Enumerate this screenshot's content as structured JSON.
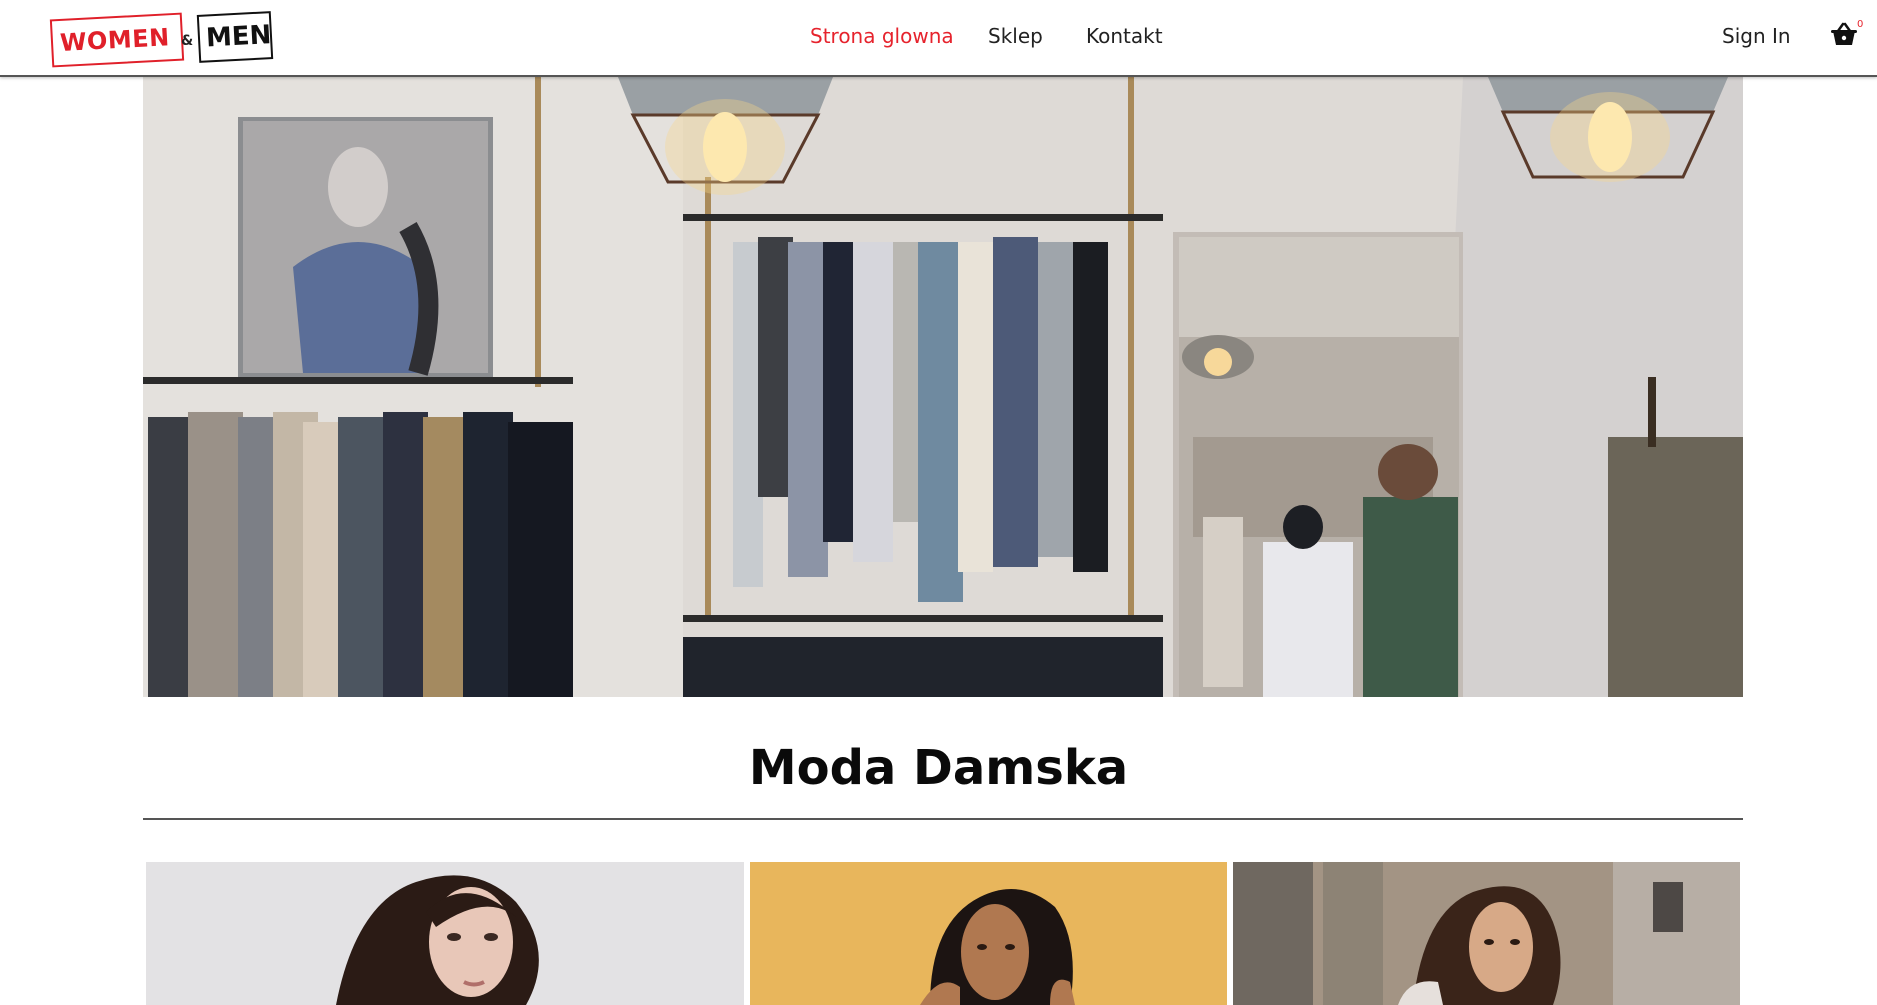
{
  "header": {
    "logo": {
      "women": "WOMEN",
      "amp": "&",
      "men": "MEN"
    },
    "nav": [
      {
        "label": "Strona glowna",
        "active": true
      },
      {
        "label": "Sklep",
        "active": false
      },
      {
        "label": "Kontakt",
        "active": false
      }
    ],
    "sign_in": "Sign In",
    "cart": {
      "icon": "basket-icon",
      "count": "0"
    }
  },
  "hero": {
    "image": "clothing-store-interior-photo"
  },
  "section": {
    "title": "Moda Damska"
  },
  "products": [
    {
      "image": "woman-dark-hair-grey-background-photo"
    },
    {
      "image": "woman-dark-hair-yellow-background-photo"
    },
    {
      "image": "woman-street-background-photo"
    }
  ],
  "colors": {
    "accent": "#e6232d",
    "text": "#222222",
    "heading": "#0a0a0a"
  }
}
